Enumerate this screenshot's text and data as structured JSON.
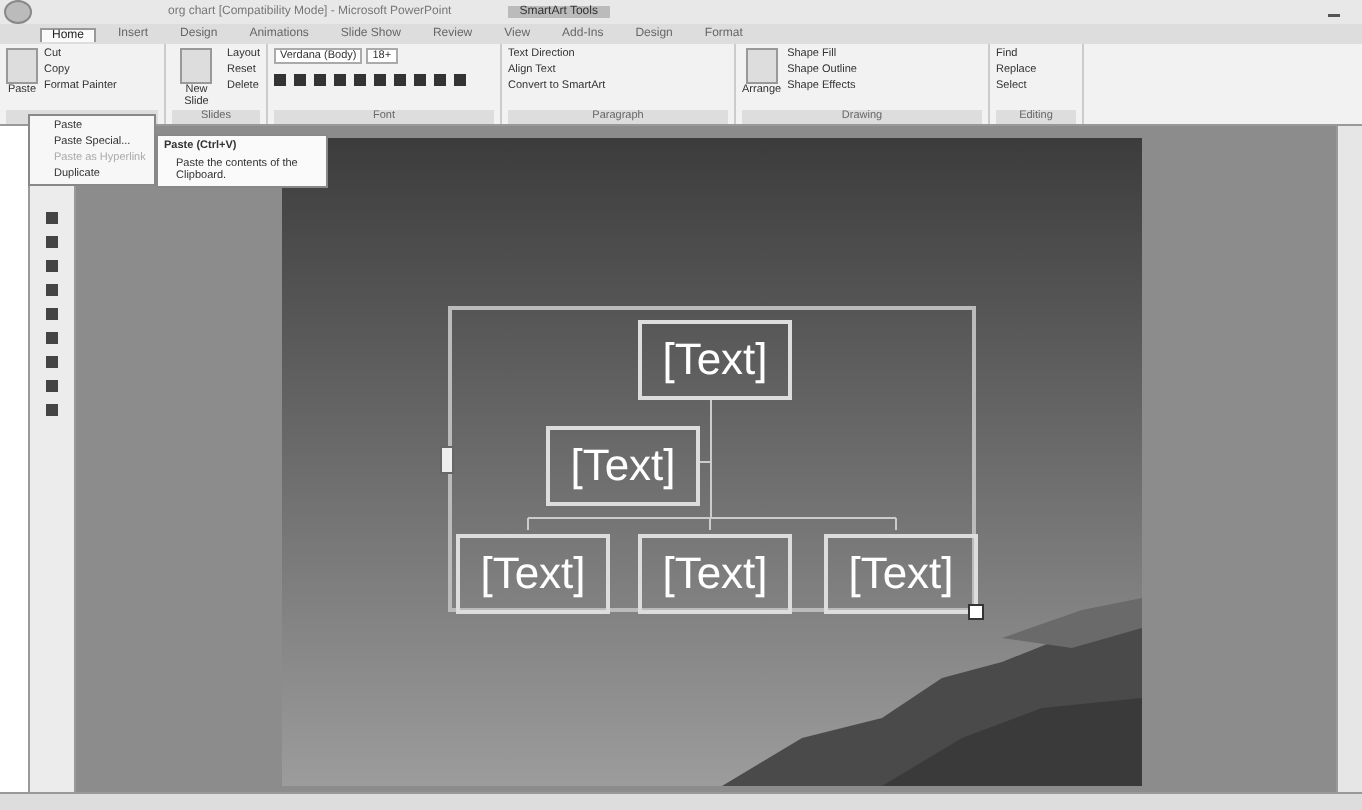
{
  "window": {
    "title": "org chart [Compatibility Mode] - Microsoft PowerPoint",
    "context_tab": "SmartArt Tools"
  },
  "tabs": [
    {
      "label": "Home",
      "selected": true
    },
    {
      "label": "Insert",
      "selected": false
    },
    {
      "label": "Design",
      "selected": false
    },
    {
      "label": "Animations",
      "selected": false
    },
    {
      "label": "Slide Show",
      "selected": false
    },
    {
      "label": "Review",
      "selected": false
    },
    {
      "label": "View",
      "selected": false
    },
    {
      "label": "Add-Ins",
      "selected": false
    },
    {
      "label": "Design",
      "selected": false
    },
    {
      "label": "Format",
      "selected": false
    }
  ],
  "groups": [
    {
      "large": "Paste",
      "items": [
        "Cut",
        "Copy",
        "Format Painter"
      ]
    },
    {
      "label": "Slides",
      "large": "New Slide",
      "items": [
        "Layout",
        "Reset",
        "Delete"
      ]
    },
    {
      "label": "Font",
      "fields": [
        "Verdana (Body)",
        "18+"
      ]
    },
    {
      "label": "Paragraph",
      "items": [
        "Text Direction",
        "Align Text",
        "Convert to SmartArt"
      ]
    },
    {
      "label": "Drawing",
      "large": "Arrange",
      "items": [
        "Shape Fill",
        "Shape Outline",
        "Shape Effects"
      ]
    },
    {
      "label": "Editing",
      "items": [
        "Find",
        "Replace",
        "Select"
      ]
    }
  ],
  "paste_menu": [
    {
      "label": "Paste",
      "disabled": false
    },
    {
      "label": "Paste Special...",
      "disabled": false
    },
    {
      "label": "Paste as Hyperlink",
      "disabled": true
    },
    {
      "label": "Duplicate",
      "disabled": false
    }
  ],
  "tooltip": {
    "title": "Paste (Ctrl+V)",
    "text": "Paste the contents of the Clipboard."
  },
  "org_chart": {
    "root": "[Text]",
    "assistant": "[Text]",
    "children": [
      "[Text]",
      "[Text]",
      "[Text]"
    ]
  }
}
